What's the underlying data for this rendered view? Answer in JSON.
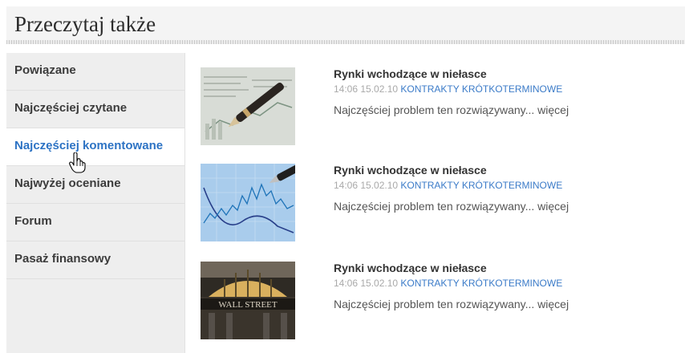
{
  "header": {
    "title": "Przeczytaj także"
  },
  "sidebar": {
    "items": [
      {
        "label": "Powiązane"
      },
      {
        "label": "Najczęściej czytane"
      },
      {
        "label": "Najczęściej komentowane"
      },
      {
        "label": "Najwyżej oceniane"
      },
      {
        "label": "Forum"
      },
      {
        "label": "Pasaż finansowy"
      }
    ]
  },
  "articles": [
    {
      "title": "Rynki wchodzące w niełasce",
      "time": "14:06 15.02.10",
      "category": "KONTRAKTY KRÓTKOTERMINOWE",
      "excerpt": "Najczęściej problem ten rozwiązywany...",
      "more": "więcej",
      "thumb": "pen-on-financial-newspaper-image"
    },
    {
      "title": "Rynki wchodzące w niełasce",
      "time": "14:06 15.02.10",
      "category": "KONTRAKTY KRÓTKOTERMINOWE",
      "excerpt": "Najczęściej problem ten rozwiązywany...",
      "more": "więcej",
      "thumb": "stock-chart-with-pen-image"
    },
    {
      "title": "Rynki wchodzące w niełasce",
      "time": "14:06 15.02.10",
      "category": "KONTRAKTY KRÓTKOTERMINOWE",
      "excerpt": "Najczęściej problem ten rozwiązywany...",
      "more": "więcej",
      "thumb": "wall-street-building-image",
      "thumb_text": "WALL STREET"
    }
  ],
  "colors": {
    "link": "#2d73c4",
    "meta": "#a9a9a9",
    "sidebar_bg": "#eeeeee"
  }
}
